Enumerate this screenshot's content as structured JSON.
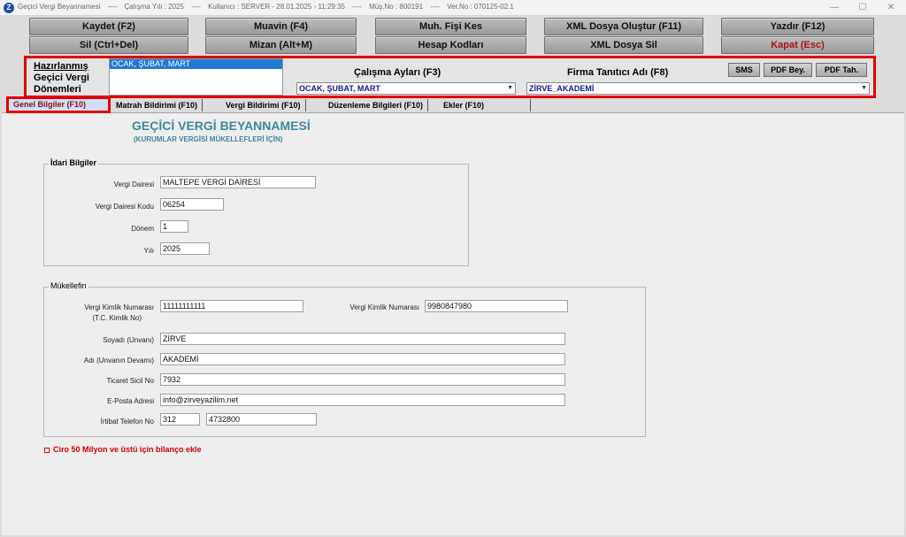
{
  "window": {
    "title": "Geçici Vergi Beyannamesi",
    "calisma_yili": "Çalışma Yılı : 2025",
    "kullanici": "Kullanıcı : SERVER - 28.01.2025 - 11:29:35",
    "musteri_no": "Müş.No : 800191",
    "versiyon": "Ver.No : 070125-02.1",
    "separator": "----",
    "controls": {
      "minimize": "—",
      "maximize": "☐",
      "close": "✕"
    }
  },
  "toolbar": {
    "row1": [
      "Kaydet (F2)",
      "Muavin (F4)",
      "Muh. Fişi Kes",
      "XML Dosya Oluştur (F11)",
      "Yazdır (F12)"
    ],
    "row2": [
      "Sil (Ctrl+Del)",
      "Mizan (Alt+M)",
      "Hesap Kodları",
      "XML Dosya Sil",
      "Kapat (Esc)"
    ],
    "accent_red": "#b01010"
  },
  "period": {
    "label_line1": "Hazırlanmış",
    "label_line2": "Geçici Vergi",
    "label_line3": "Dönemleri",
    "list_selected": "OCAK, ŞUBAT, MART",
    "calisma_aylari_label": "Çalışma Ayları (F3)",
    "calisma_aylari_value": "OCAK, ŞUBAT, MART",
    "firma_label": "Firma Tanıtıcı Adı (F8)",
    "firma_value": "ZİRVE_AKADEMİ",
    "sms": "SMS",
    "pdf_bey": "PDF Bey.",
    "pdf_tah": "PDF Tah.",
    "highlight_color": "#e10000"
  },
  "tabs": [
    "Genel Bilgiler (F10)",
    "Matrah Bildirimi (F10)",
    "Vergi Bildirimi (F10)",
    "Düzenleme Bilgileri (F10)",
    "Ekler (F10)"
  ],
  "form": {
    "title": "GEÇİCİ VERGİ BEYANNAMESİ",
    "subtitle": "(KURUMLAR VERGİSİ MÜKELLEFLERİ İÇİN)",
    "title_color": "#3c8a9a"
  },
  "idari": {
    "title": "İdari Bilgiler",
    "vergi_dairesi_label": "Vergi Dairesi",
    "vergi_dairesi": "MALTEPE VERGİ DAİRESİ",
    "vergi_dairesi_kodu_label": "Vergi Dairesi Kodu",
    "vergi_dairesi_kodu": "06254",
    "donem_label": "Dönem",
    "donem": "1",
    "yil_label": "Yılı",
    "yil": "2025"
  },
  "mukellef": {
    "title": "Mükellefin",
    "vkn_label": "Vergi Kimlik Numarası",
    "vkn_label2": "(T.C. Kimlik No)",
    "vkn": "11111111111",
    "vkn2_label": "Vergi Kimlik Numarası",
    "vkn2": "9980847980",
    "soyadi_label": "Soyadı (Unvanı)",
    "soyadi": "ZİRVE",
    "adi_label": "Adı (Unvanın Devamı)",
    "adi": "AKADEMİ",
    "sicil_label": "Ticaret Sicil No",
    "sicil": "7932",
    "eposta_label": "E-Posta Adresi",
    "eposta": "info@zirveyazilim.net",
    "telefon_label": "İrtibat Telefon No",
    "telefon_kod": "312",
    "telefon_no": "4732800"
  },
  "bilanco_check": "Ciro 50 Milyon ve üstü için bilanço ekle"
}
